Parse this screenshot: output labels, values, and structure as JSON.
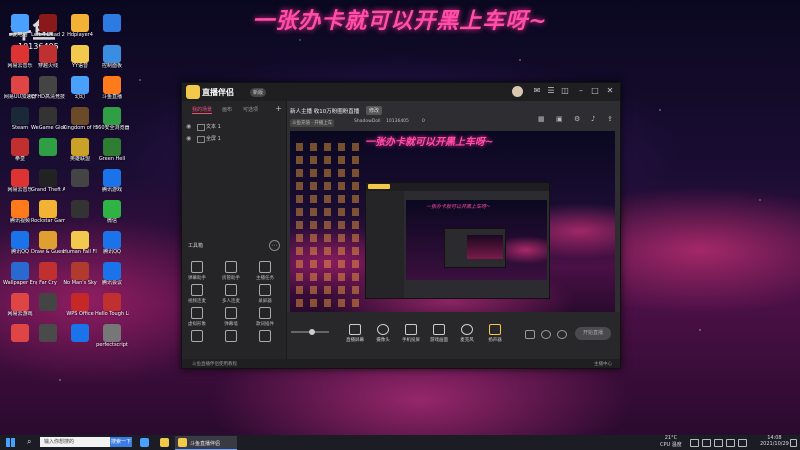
{
  "overlay_banner": "一张办卡就可以开黑上车呀~",
  "watermark": {
    "logo": "斗鱼",
    "room_no": "10136405"
  },
  "desktop_icons": [
    {
      "label": "此电脑",
      "color": "#4aa0ff"
    },
    {
      "label": "Left 4 Dead 2",
      "color": "#8a1a1a"
    },
    {
      "label": "Hdplayer4",
      "color": "#f2b233"
    },
    {
      "label": "",
      "color": "#2d7be0"
    },
    {
      "label": "网易云音乐",
      "color": "#d33"
    },
    {
      "label": "穿越火线",
      "color": "#c03030"
    },
    {
      "label": "YY语音",
      "color": "#f2c94c"
    },
    {
      "label": "控制面板",
      "color": "#3a8de0"
    },
    {
      "label": "网易UU加速器",
      "color": "#e04545"
    },
    {
      "label": "CFHD高清竞技大区",
      "color": "#444"
    },
    {
      "label": "幻幻",
      "color": "#4aa0ff"
    },
    {
      "label": "斗鱼直播",
      "color": "#ff7a1a"
    },
    {
      "label": "Steam",
      "color": "#1b2838"
    },
    {
      "label": "WeGame Global",
      "color": "#333"
    },
    {
      "label": "Kingdom of Heaven 2",
      "color": "#6b4a2a"
    },
    {
      "label": "360安全浏览器",
      "color": "#2f9e44"
    },
    {
      "label": "拳皇",
      "color": "#c03030"
    },
    {
      "label": "",
      "color": "#2f9e44"
    },
    {
      "label": "英雄联盟",
      "color": "#c9a227"
    },
    {
      "label": "Green Hell",
      "color": "#2e7d32"
    },
    {
      "label": "网易云音乐",
      "color": "#d33"
    },
    {
      "label": "Grand Theft Auto V",
      "color": "#222"
    },
    {
      "label": "",
      "color": "#444"
    },
    {
      "label": "腾讯游戏",
      "color": "#1a73e8"
    },
    {
      "label": "腾讯视频",
      "color": "#ff7a1a"
    },
    {
      "label": "Rockstar Games",
      "color": "#f2b233"
    },
    {
      "label": "",
      "color": "#333"
    },
    {
      "label": "微信",
      "color": "#2fb344"
    },
    {
      "label": "腾讯QQ",
      "color": "#1a73e8"
    },
    {
      "label": "Draw & Guess",
      "color": "#e0a030"
    },
    {
      "label": "Human Fall Flat",
      "color": "#f2c94c"
    },
    {
      "label": "腾讯QQ",
      "color": "#1a73e8"
    },
    {
      "label": "Wallpaper Engine",
      "color": "#2a6ad0"
    },
    {
      "label": "Far Cry",
      "color": "#c03030"
    },
    {
      "label": "No Man's Sky",
      "color": "#b03a2e"
    },
    {
      "label": "腾讯会议",
      "color": "#1a73e8"
    },
    {
      "label": "网易云游戏",
      "color": "#e04545"
    },
    {
      "label": "",
      "color": "#444"
    },
    {
      "label": "WPS Office",
      "color": "#c62828"
    },
    {
      "label": "Hello Tough Life",
      "color": "#c03030"
    },
    {
      "label": "",
      "color": "#e04545"
    },
    {
      "label": "",
      "color": "#4a4a4a"
    },
    {
      "label": "",
      "color": "#1a73e8"
    },
    {
      "label": "perfectscript",
      "color": "#777"
    }
  ],
  "app": {
    "name": "直播伴侣",
    "version": "新版",
    "tabs": [
      "我的场景",
      "画布",
      "可选项"
    ],
    "scenes": [
      "文本 1",
      "全屏 1"
    ],
    "tools_header": "工具箱",
    "tools": [
      "弹幕助手",
      "房管助手",
      "主播任务",
      "视频连麦",
      "多人连麦",
      "录屏器",
      "虚拟形象",
      "弹幕墙",
      "歌词插件",
      "",
      "",
      ""
    ],
    "room_title": "新人主播 收10万粉圈粉直播",
    "room_tag": "修改",
    "room_meta": [
      "斗鱼充值 · 开播上车",
      "ShadowDoll",
      "10136405",
      "0"
    ],
    "preview_banner": "一张办卡就可以开黑上车呀~",
    "nested_banner": "一张办卡就可以开黑上车呀~",
    "bottom_buttons": [
      "直播屏幕",
      "摄像头",
      "手机投屏",
      "游戏画面",
      "麦克风",
      "扬声器"
    ],
    "go_live": "开始直播",
    "status_left": "斗鱼直播伴侣使用教程",
    "status_right": "主播中心"
  },
  "taskbar": {
    "search_placeholder": "输入你想搜的",
    "search_button": "搜索一下",
    "active_app": "斗鱼直播伴侣",
    "weather": "21°C",
    "weather_text": "CPU 温度",
    "time": "14:08",
    "date": "2021/10/29"
  }
}
